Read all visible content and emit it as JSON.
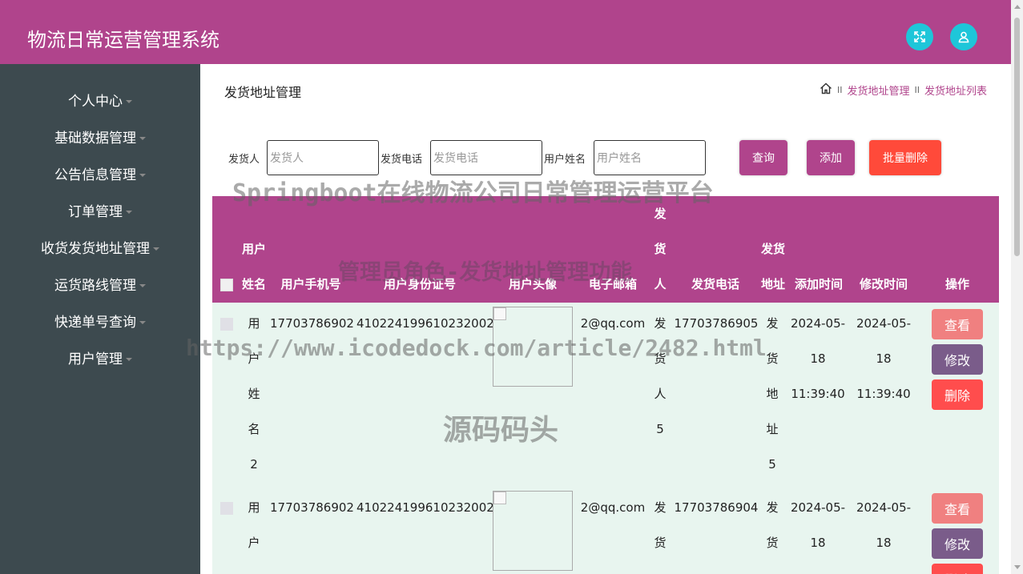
{
  "app_title": "物流日常运营管理系统",
  "sidebar": {
    "items": [
      {
        "label": "个人中心"
      },
      {
        "label": "基础数据管理"
      },
      {
        "label": "公告信息管理"
      },
      {
        "label": "订单管理"
      },
      {
        "label": "收货发货地址管理"
      },
      {
        "label": "运货路线管理"
      },
      {
        "label": "快递单号查询"
      },
      {
        "label": "用户管理"
      }
    ]
  },
  "page": {
    "title": "发货地址管理",
    "breadcrumb": [
      "发货地址管理",
      "发货地址列表"
    ],
    "breadcrumb_sep": "II"
  },
  "search": {
    "fields": [
      {
        "label": "发货人",
        "placeholder": "发货人"
      },
      {
        "label": "发货电话",
        "placeholder": "发货电话"
      },
      {
        "label": "用户姓名",
        "placeholder": "用户姓名"
      }
    ],
    "query_label": "查询",
    "add_label": "添加",
    "batch_delete_label": "批量删除"
  },
  "colors": {
    "brand": "#b0448c",
    "accent": "#1ec6d9",
    "sidebar_bg": "#3d4a4f",
    "row_bg": "#e8f5ef",
    "btn_view": "#f08080",
    "btn_edit": "#7a5c8a",
    "btn_delete": "#ff4d4d"
  },
  "table": {
    "headers": {
      "user_name": [
        "用户",
        "姓名"
      ],
      "user_phone": "用户手机号",
      "user_id_card": "用户身份证号",
      "user_avatar": "用户头像",
      "email": "电子邮箱",
      "sender": [
        "发",
        "货",
        "人"
      ],
      "sender_phone": "发货电话",
      "address": [
        "发货",
        "地址"
      ],
      "created": "添加时间",
      "modified": "修改时间",
      "ops": "操作"
    },
    "rows": [
      {
        "user_name": [
          "用",
          "户",
          "姓",
          "名",
          "2"
        ],
        "user_phone": "17703786902",
        "user_id_card": "410224199610232002",
        "email": "2@qq.com",
        "sender": [
          "发",
          "货",
          "人",
          "5"
        ],
        "sender_phone": "17703786905",
        "address": [
          "发",
          "货",
          "地",
          "址",
          "5"
        ],
        "created": [
          "2024-05-",
          "18",
          "11:39:40"
        ],
        "modified": [
          "2024-05-",
          "18",
          "11:39:40"
        ]
      },
      {
        "user_name": [
          "用",
          "户"
        ],
        "user_phone": "17703786902",
        "user_id_card": "410224199610232002",
        "email": "2@qq.com",
        "sender": [
          "发",
          "货"
        ],
        "sender_phone": "17703786904",
        "address": [
          "发",
          "货"
        ],
        "created": [
          "2024-05-",
          "18"
        ],
        "modified": [
          "2024-05-",
          "18"
        ]
      }
    ],
    "actions": {
      "view": "查看",
      "edit": "修改",
      "delete": "删除"
    }
  },
  "watermarks": {
    "line1": "Springboot在线物流公司日常管理运营平台",
    "line2": "管理员角色-发货地址管理功能",
    "line3": "https://www.icodedock.com/article/2482.html",
    "line4": "源码码头"
  }
}
